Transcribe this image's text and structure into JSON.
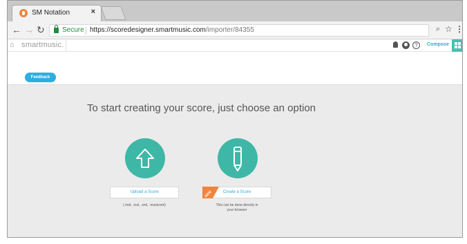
{
  "browser": {
    "tab_title": "SM Notation",
    "tab_close": "×",
    "secure_label": "Secure",
    "url_host": "https://scoredesigner.smartmusic.com",
    "url_path": "/importer/84355"
  },
  "app": {
    "brand": "smartmusic.",
    "compose_label": "Compose",
    "help_label": "?",
    "feedback_label": "Feedback"
  },
  "main": {
    "headline": "To start creating your score, just choose an option",
    "upload": {
      "label": "Upload a Score",
      "note": "(.mid, .mxl, .xml, .musicxml)"
    },
    "create": {
      "label": "Create a Score",
      "badge": "NEW",
      "note_line1": "This can be done directly in",
      "note_line2": "your browser"
    }
  },
  "colors": {
    "accent_teal": "#3fb7a7",
    "feedback_blue": "#2eaee0",
    "badge_orange": "#f0843c",
    "secure_green": "#1e8e3e"
  },
  "icons": [
    "back-arrow-icon",
    "forward-arrow-icon",
    "reload-icon",
    "lock-icon",
    "zoom-icon",
    "star-icon",
    "menu-icon",
    "home-icon",
    "bell-icon",
    "user-icon",
    "help-icon",
    "grid-icon",
    "upload-arrow-icon",
    "pencil-icon"
  ]
}
